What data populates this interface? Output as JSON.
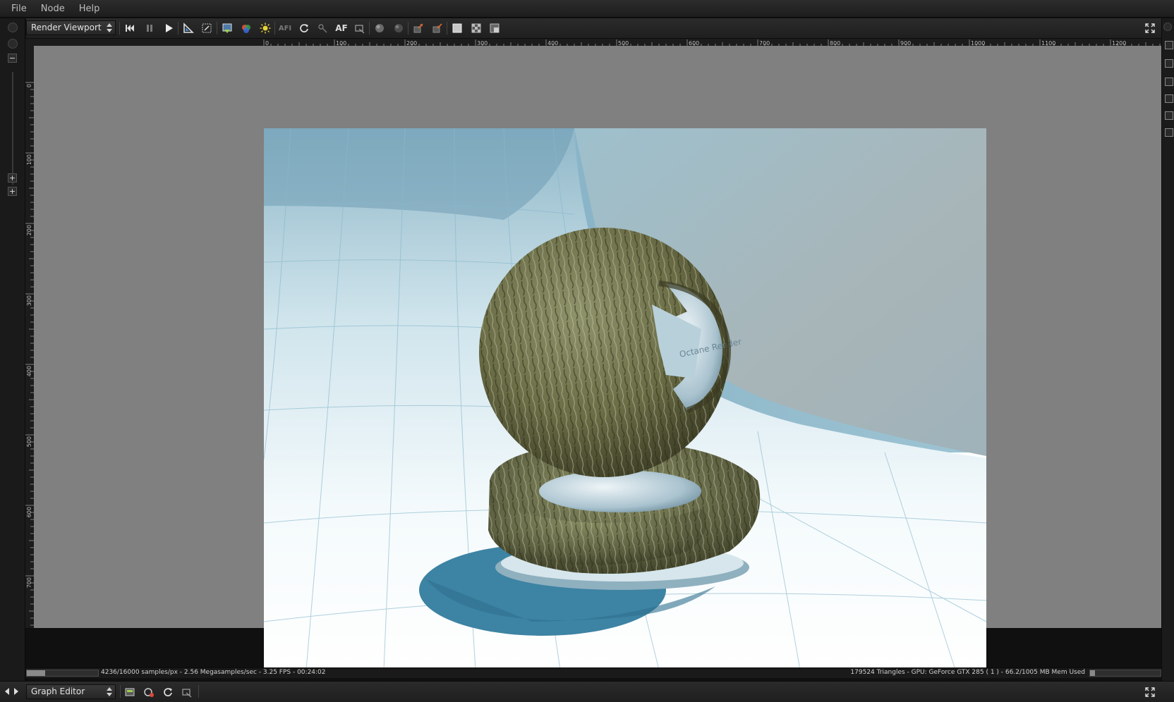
{
  "menu": [
    {
      "label": "File"
    },
    {
      "label": "Node"
    },
    {
      "label": "Help"
    }
  ],
  "toolbar": {
    "view_select": "Render Viewport",
    "buttons": [
      {
        "name": "restart-icon"
      },
      {
        "name": "pause-icon"
      },
      {
        "name": "play-icon"
      },
      {
        "name": "set-square-icon"
      },
      {
        "name": "region-icon"
      },
      {
        "name": "save-render-icon"
      },
      {
        "name": "color-picker-icon"
      },
      {
        "name": "sun-icon"
      },
      {
        "name": "auto-focus-disabled-icon"
      },
      {
        "name": "refresh-icon"
      },
      {
        "name": "pick-focus-icon"
      },
      {
        "name": "af-text-icon"
      },
      {
        "name": "material-pick-icon"
      },
      {
        "name": "sphere-grey-icon"
      },
      {
        "name": "sphere-dark-icon"
      },
      {
        "name": "export-icon"
      },
      {
        "name": "import-icon"
      },
      {
        "name": "white-square-icon"
      },
      {
        "name": "checker-icon"
      },
      {
        "name": "overlay-icon"
      }
    ],
    "af_label": "AF",
    "af_dim_label": "AFI"
  },
  "ruler": {
    "top_ticks": [
      "0",
      "100",
      "200",
      "300",
      "400",
      "500",
      "600",
      "700",
      "800",
      "900",
      "1000",
      "1100",
      "1200"
    ],
    "left_ticks": [
      "0",
      "100",
      "200",
      "300",
      "400",
      "500",
      "600",
      "700",
      "800"
    ]
  },
  "render": {
    "watermark_text": "Octane Render"
  },
  "status": {
    "left_text": "4236/16000 samples/px - 2.56 Megasamples/sec - 3.25 FPS - 00:24:02",
    "right_text": "179524 Triangles - GPU: GeForce GTX 285 ( 1 ) - 66.2/1005 MB Mem Used",
    "progress_fraction": 0.26,
    "mem_fraction": 0.066
  },
  "graph": {
    "select_label": "Graph Editor"
  },
  "colors": {
    "viewport_bg": "#808080",
    "chrome_bg": "#1e1e1e",
    "sky": "#8ab6c8",
    "shadow": "#3d83a3"
  }
}
